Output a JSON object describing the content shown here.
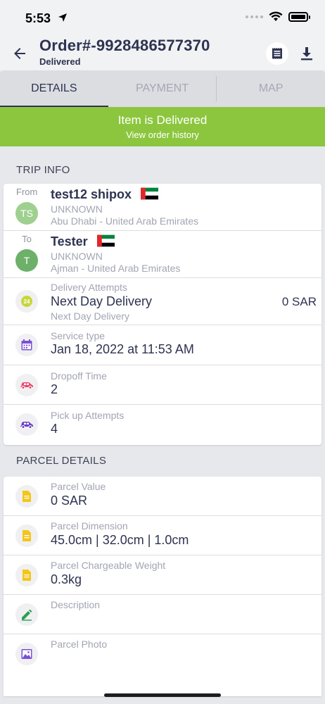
{
  "status_bar": {
    "time": "5:53"
  },
  "header": {
    "order_title": "Order#-9928486577370",
    "order_status": "Delivered"
  },
  "tabs": [
    {
      "label": "DETAILS",
      "active": true
    },
    {
      "label": "PAYMENT",
      "active": false
    },
    {
      "label": "MAP",
      "active": false
    }
  ],
  "banner": {
    "title": "Item is Delivered",
    "link": "View order history",
    "color": "#8cc63f"
  },
  "trip_info": {
    "section_title": "TRIP INFO",
    "from": {
      "side_label": "From",
      "initials": "TS",
      "avatar_color": "#9fd08f",
      "name": "test12 shipox",
      "line1": "UNKNOWN",
      "line2": "Abu Dhabi - United Arab Emirates"
    },
    "to": {
      "side_label": "To",
      "initials": "T",
      "avatar_color": "#6db06a",
      "name": "Tester",
      "line1": "UNKNOWN",
      "line2": "Ajman - United Arab Emirates"
    },
    "delivery": {
      "label": "Delivery Attempts",
      "value": "Next Day Delivery",
      "sub": "Next Day Delivery",
      "price": "0 SAR",
      "icon_text": "24"
    },
    "service": {
      "label": "Service type",
      "value": "Jan 18, 2022 at 11:53 AM"
    },
    "dropoff": {
      "label": "Dropoff Time",
      "value": "2"
    },
    "pickup": {
      "label": "Pick up Attempts",
      "value": "4"
    }
  },
  "parcel_details": {
    "section_title": "PARCEL DETAILS",
    "value": {
      "label": "Parcel Value",
      "value": "0 SAR"
    },
    "dimension": {
      "label": "Parcel Dimension",
      "value": "45.0cm | 32.0cm | 1.0cm"
    },
    "weight": {
      "label": "Parcel Chargeable Weight",
      "value": "0.3kg"
    },
    "description": {
      "label": "Description",
      "value": ""
    },
    "photo": {
      "label": "Parcel Photo"
    }
  }
}
